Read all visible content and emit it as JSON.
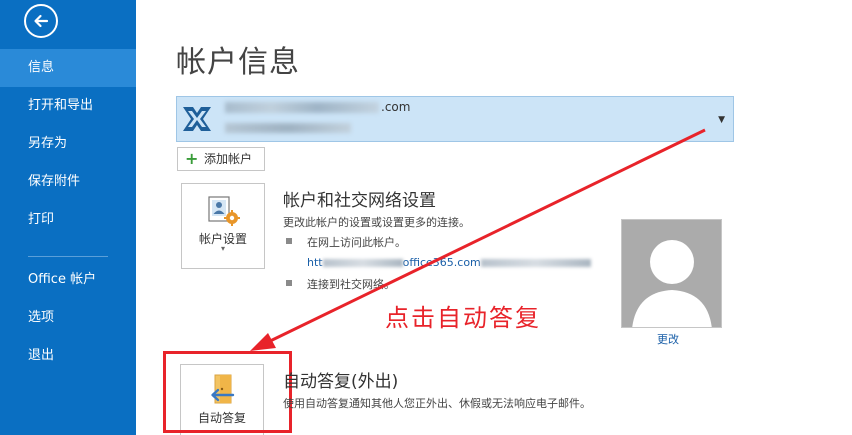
{
  "sidebar": {
    "items": [
      {
        "label": "信息",
        "active": true
      },
      {
        "label": "打开和导出"
      },
      {
        "label": "另存为"
      },
      {
        "label": "保存附件"
      },
      {
        "label": "打印"
      },
      {
        "label": "Office 帐户"
      },
      {
        "label": "选项"
      },
      {
        "label": "退出"
      }
    ]
  },
  "main": {
    "title": "帐户信息",
    "account": {
      "email_suffix": ".com",
      "dropdown_icon": "caret-down-icon"
    },
    "add_account_label": "添加帐户",
    "settings_tile": {
      "label": "帐户设置",
      "caret": "▾",
      "title": "帐户和社交网络设置",
      "desc": "更改此帐户的设置或设置更多的连接。",
      "bullet1": "在网上访问此帐户。",
      "link_prefix": "htt",
      "link_mid": "office365.com",
      "bullet2": "连接到社交网络。"
    },
    "photo_change_label": "更改",
    "auto_reply": {
      "tile_label": "自动答复",
      "title": "自动答复(外出)",
      "desc": "使用自动答复通知其他人您正外出、休假或无法响应电子邮件。"
    }
  },
  "annotation": {
    "text": "点击自动答复",
    "color": "#e8232a"
  },
  "colors": {
    "sidebar_bg": "#0a6fc2",
    "sidebar_active": "#2a8ad8",
    "account_bg": "#cce4f7"
  }
}
